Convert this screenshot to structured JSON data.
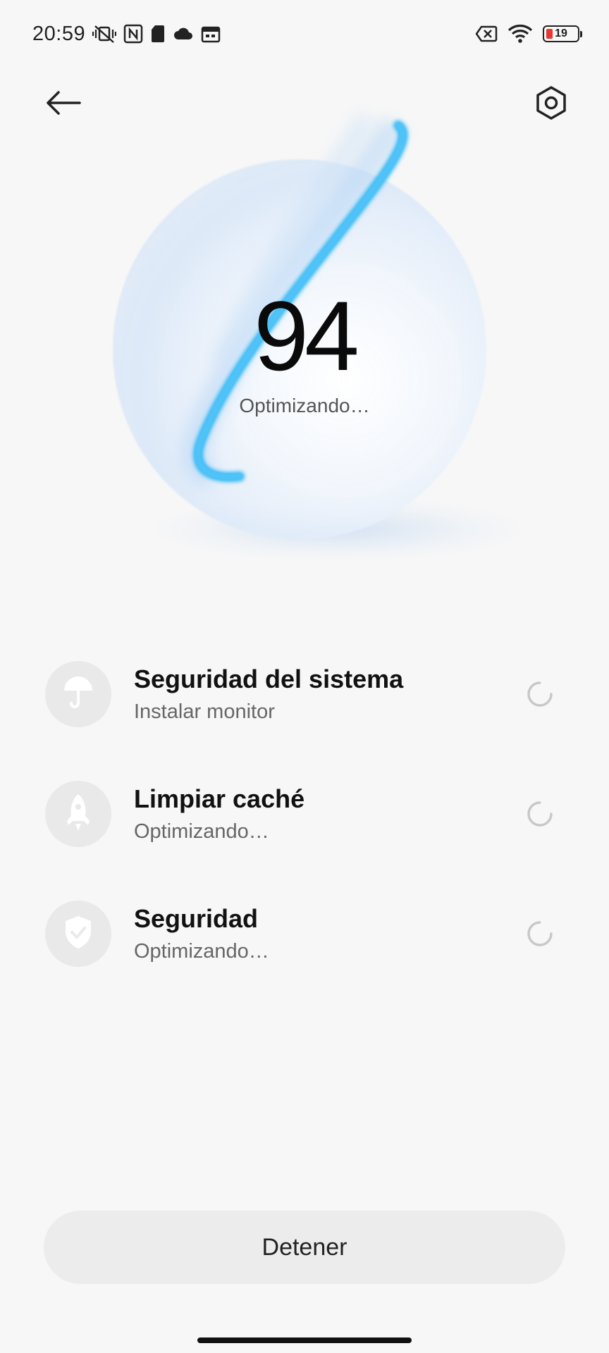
{
  "status_bar": {
    "time": "20:59",
    "battery_level": "19",
    "battery_percent": 19,
    "left_icons": [
      "vibrate-muted-icon",
      "nfc-icon",
      "sim-card-icon",
      "cloud-icon",
      "calendar-icon"
    ],
    "right_icons": [
      "no-data-icon",
      "wifi-icon",
      "battery-icon"
    ]
  },
  "header": {
    "back_icon": "arrow-left-icon",
    "settings_icon": "hexagon-settings-icon"
  },
  "hero": {
    "score": "94",
    "status": "Optimizando…",
    "accent_color": "#29b6f6"
  },
  "tasks": [
    {
      "title": "Seguridad del sistema",
      "subtitle": "Instalar monitor",
      "icon": "umbrella-icon"
    },
    {
      "title": "Limpiar caché",
      "subtitle": "Optimizando…",
      "icon": "rocket-icon"
    },
    {
      "title": "Seguridad",
      "subtitle": "Optimizando…",
      "icon": "shield-check-icon"
    }
  ],
  "footer": {
    "stop_label": "Detener"
  }
}
